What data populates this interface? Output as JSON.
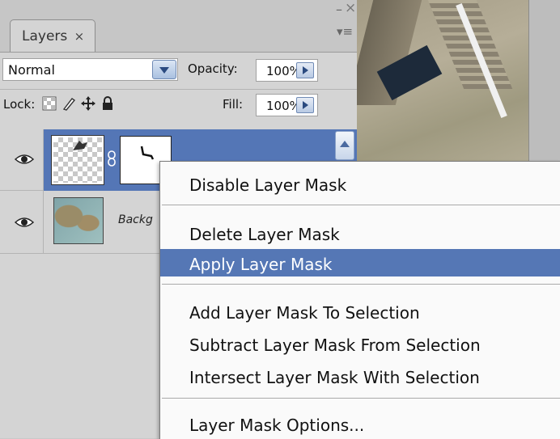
{
  "panel": {
    "tab_label": "Layers",
    "tab_close": "×",
    "minimize": "–",
    "close": "×",
    "menu": "▾≡"
  },
  "blend": {
    "mode": "Normal"
  },
  "opacity": {
    "label": "Opacity:",
    "value": "100%"
  },
  "lock": {
    "label": "Lock:",
    "icons": [
      "lock-transparent-icon",
      "lock-image-icon",
      "lock-position-icon",
      "lock-all-icon"
    ]
  },
  "fill": {
    "label": "Fill:",
    "value": "100%"
  },
  "layers": [
    {
      "name": "",
      "selected": true,
      "has_mask": true
    },
    {
      "name": "Backg",
      "selected": false,
      "has_mask": false
    }
  ],
  "context_menu": {
    "items": [
      {
        "label": "Disable Layer Mask",
        "highlighted": false
      },
      {
        "label": "Delete Layer Mask",
        "highlighted": false
      },
      {
        "label": "Apply Layer Mask",
        "highlighted": true
      },
      {
        "label": "Add Layer Mask To Selection",
        "highlighted": false
      },
      {
        "label": "Subtract Layer Mask From Selection",
        "highlighted": false
      },
      {
        "label": "Intersect Layer Mask With Selection",
        "highlighted": false
      },
      {
        "label": "Layer Mask Options...",
        "highlighted": false
      }
    ]
  },
  "colors": {
    "selection": "#5476b6",
    "menu_highlight": "#5577b5",
    "panel_bg": "#d4d4d4"
  }
}
